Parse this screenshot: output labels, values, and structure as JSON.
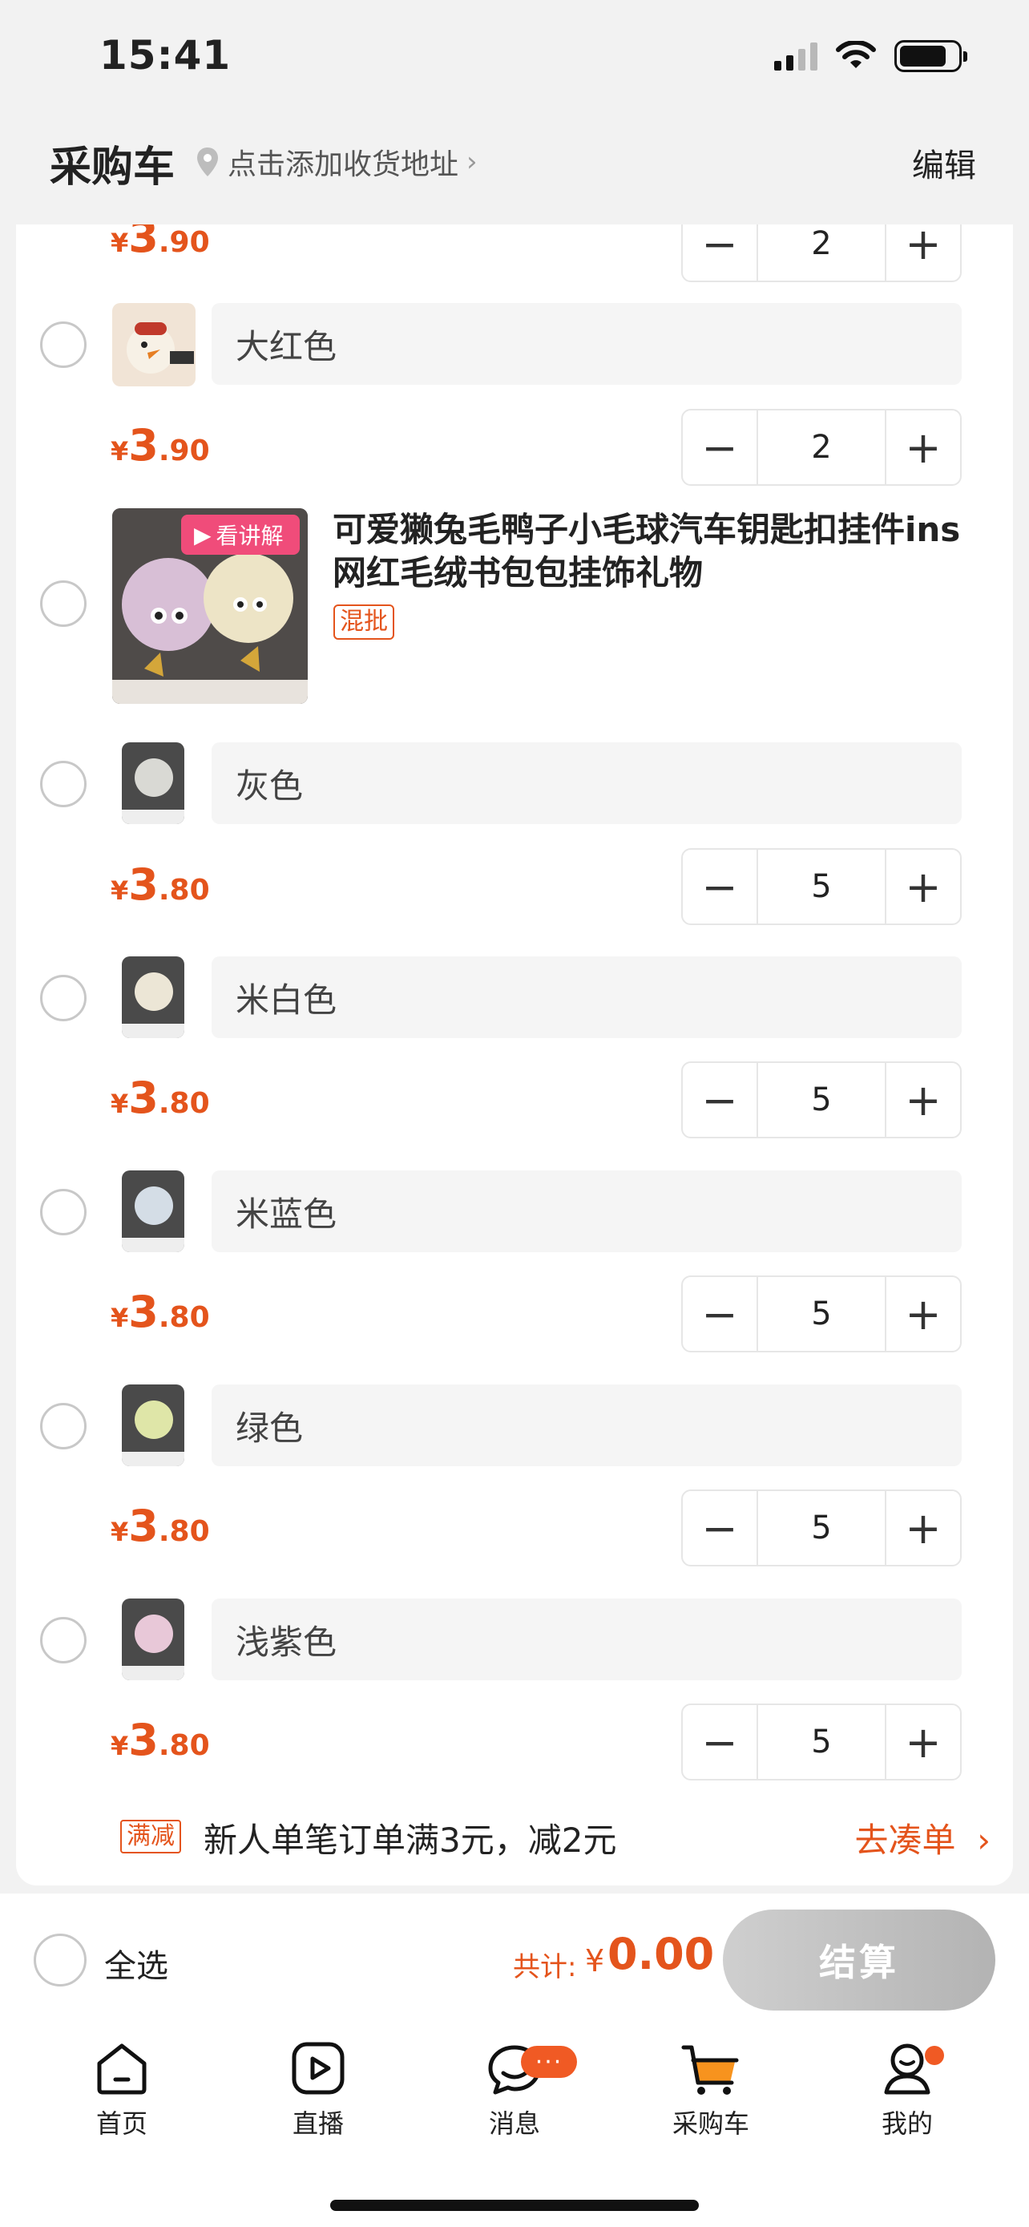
{
  "status_bar": {
    "time": "15:41"
  },
  "header": {
    "title": "采购车",
    "address_prompt": "点击添加收货地址",
    "edit_label": "编辑"
  },
  "cart": {
    "items": [
      {
        "variant": null,
        "price_yen": "¥",
        "price_int": "3",
        "price_dec": ".90",
        "qty": "2"
      },
      {
        "variant": "大红色",
        "price_yen": "¥",
        "price_int": "3",
        "price_dec": ".90",
        "qty": "2"
      }
    ],
    "product": {
      "title": "可爱獭兔毛鸭子小毛球汽车钥匙扣挂件ins网红毛绒书包包挂饰礼物",
      "tag": "混批",
      "video_badge": "看讲解",
      "variants": [
        {
          "name": "灰色",
          "price_yen": "¥",
          "price_int": "3",
          "price_dec": ".80",
          "qty": "5",
          "thumb_color": "#d9d9d4"
        },
        {
          "name": "米白色",
          "price_yen": "¥",
          "price_int": "3",
          "price_dec": ".80",
          "qty": "5",
          "thumb_color": "#ece6d6"
        },
        {
          "name": "米蓝色",
          "price_yen": "¥",
          "price_int": "3",
          "price_dec": ".80",
          "qty": "5",
          "thumb_color": "#d4dde6"
        },
        {
          "name": "绿色",
          "price_yen": "¥",
          "price_int": "3",
          "price_dec": ".80",
          "qty": "5",
          "thumb_color": "#dfe6a8"
        },
        {
          "name": "浅紫色",
          "price_yen": "¥",
          "price_int": "3",
          "price_dec": ".80",
          "qty": "5",
          "thumb_color": "#e8c8d8"
        }
      ]
    },
    "promo": {
      "tag": "满减",
      "text": "新人单笔订单满3元，减2元",
      "link": "去凑单"
    }
  },
  "checkout": {
    "select_all": "全选",
    "total_label": "共计:",
    "total_yen": "¥",
    "total_amount": "0.00",
    "button": "结算"
  },
  "tabs": [
    {
      "label": "首页",
      "icon": "home-icon"
    },
    {
      "label": "直播",
      "icon": "live-play-icon"
    },
    {
      "label": "消息",
      "icon": "message-icon",
      "badge": "···"
    },
    {
      "label": "采购车",
      "icon": "cart-icon"
    },
    {
      "label": "我的",
      "icon": "profile-icon"
    }
  ],
  "colors": {
    "accent": "#e4541c",
    "badge": "#f05a24",
    "checkout_disabled": "#c2c2c2"
  }
}
